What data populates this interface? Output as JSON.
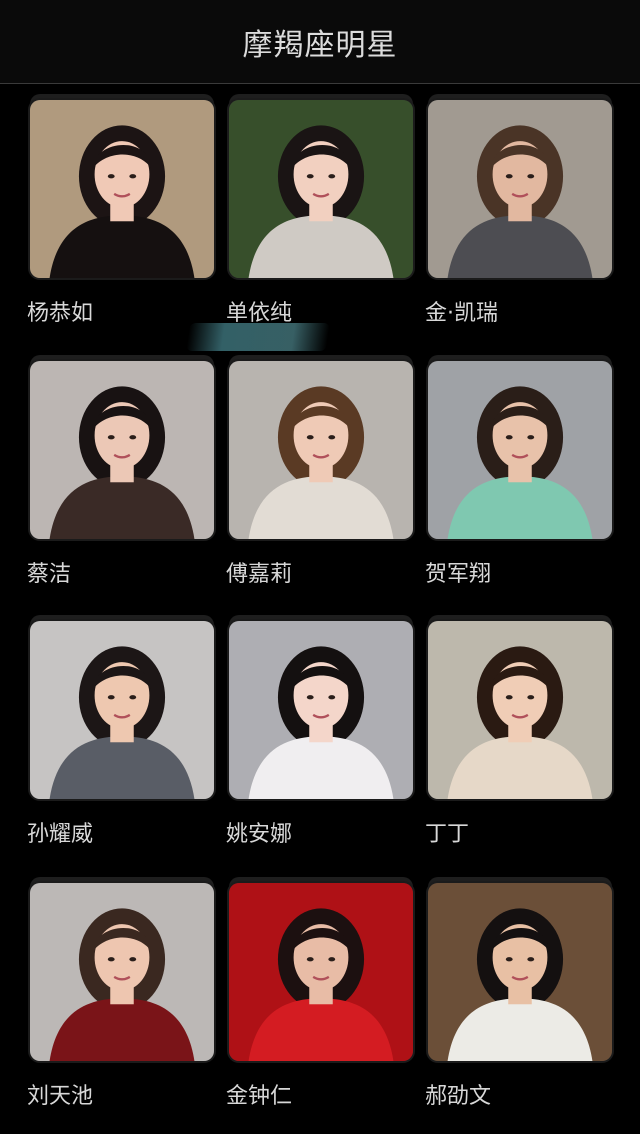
{
  "header": {
    "title": "摩羯座明星"
  },
  "celebrities": [
    {
      "name": "杨恭如",
      "bg": "#c9b090",
      "skin": "#f0c9b6",
      "hair": "#1c1414",
      "outfit": "#151010"
    },
    {
      "name": "单依纯",
      "bg": "#3f5a32",
      "skin": "#f2d0c0",
      "hair": "#1a1414",
      "outfit": "#cfcac4"
    },
    {
      "name": "金·凯瑞",
      "bg": "#b8b0a6",
      "skin": "#e2b8a0",
      "hair": "#4a3426",
      "outfit": "#4d4d52"
    },
    {
      "name": "蔡洁",
      "bg": "#d6d0cc",
      "skin": "#ecc8b6",
      "hair": "#181212",
      "outfit": "#3a2a26"
    },
    {
      "name": "傅嘉莉",
      "bg": "#d2cdc8",
      "skin": "#efcab6",
      "hair": "#5a3a24",
      "outfit": "#e2dcd4"
    },
    {
      "name": "贺军翔",
      "bg": "#b6b9bd",
      "skin": "#e8c2aa",
      "hair": "#2a1e18",
      "outfit": "#7fc8b0"
    },
    {
      "name": "孙耀威",
      "bg": "#e2e0de",
      "skin": "#eec8b0",
      "hair": "#1c1616",
      "outfit": "#595d66"
    },
    {
      "name": "姚安娜",
      "bg": "#c7c7cc",
      "skin": "#f4d6ca",
      "hair": "#141010",
      "outfit": "#f0eef0"
    },
    {
      "name": "丁丁",
      "bg": "#d8d2c4",
      "skin": "#f0cdb6",
      "hair": "#2a1a12",
      "outfit": "#e6d8c8"
    },
    {
      "name": "刘天池",
      "bg": "#d6d2d0",
      "skin": "#eec6b0",
      "hair": "#3a2820",
      "outfit": "#7a1418"
    },
    {
      "name": "金钟仁",
      "bg": "#c8141a",
      "skin": "#e8bca6",
      "hair": "#1c1010",
      "outfit": "#d41c22"
    },
    {
      "name": "郝劭文",
      "bg": "#7a5a40",
      "skin": "#e8c0a4",
      "hair": "#141010",
      "outfit": "#ecebe6"
    }
  ]
}
